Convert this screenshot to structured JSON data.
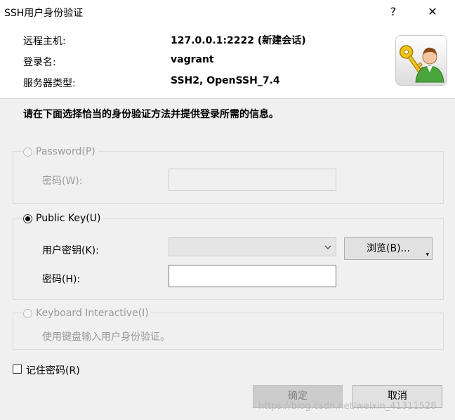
{
  "window": {
    "title": "SSH用户身份验证",
    "help_glyph": "?",
    "close_glyph": "✕"
  },
  "session": {
    "remote_host_label": "远程主机:",
    "remote_host_value": "127.0.0.1:2222 (新建会话)",
    "login_label": "登录名:",
    "login_value": "vagrant",
    "server_type_label": "服务器类型:",
    "server_type_value": "SSH2, OpenSSH_7.4",
    "logo_icon": "user-key-icon"
  },
  "instruction": "请在下面选择恰当的身份验证方法并提供登录所需的信息。",
  "auth": {
    "password": {
      "option_label": "Password(P)",
      "selected": false,
      "enabled": false,
      "password_label": "密码(W):",
      "password_value": ""
    },
    "public_key": {
      "option_label": "Public Key(U)",
      "selected": true,
      "enabled": true,
      "user_key_label": "用户密钥(K):",
      "user_key_value": "",
      "browse_label": "浏览(B)...",
      "passphrase_label": "密码(H):",
      "passphrase_value": ""
    },
    "keyboard_interactive": {
      "option_label": "Keyboard Interactive(I)",
      "selected": false,
      "enabled": false,
      "description": "使用键盘输入用户身份验证。"
    }
  },
  "remember_password": {
    "label": "记住密码(R)",
    "checked": false
  },
  "buttons": {
    "ok_label": "确定",
    "cancel_label": "取消"
  },
  "watermark": "https://blog.csdn.net/weixin_41311528"
}
